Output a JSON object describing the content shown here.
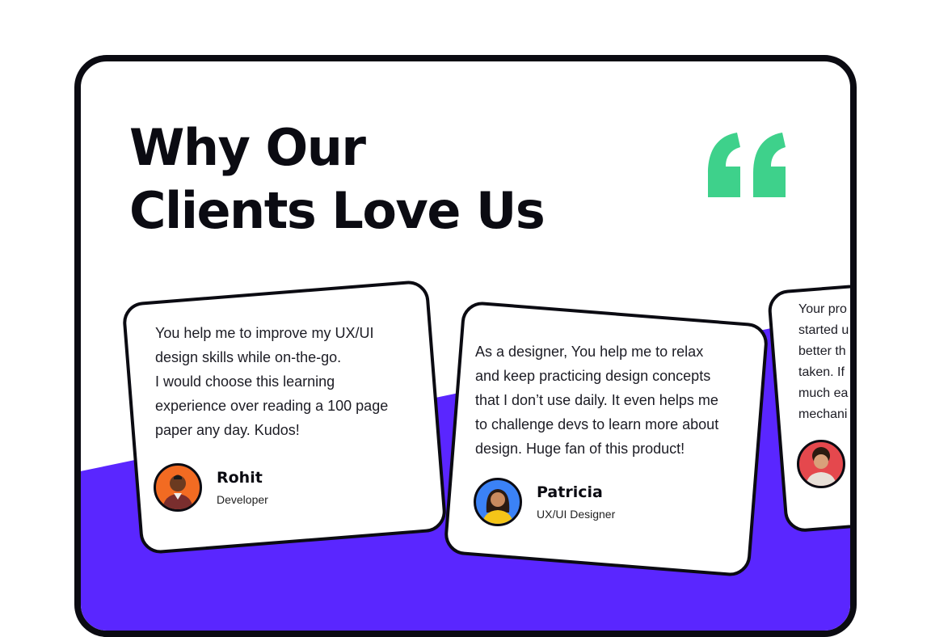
{
  "heading": {
    "line1": "Why Our",
    "line2": "Clients Love Us"
  },
  "quote_icon": {
    "name": "quote-icon",
    "color": "#3ed18b"
  },
  "colors": {
    "accent_purple": "#5a26ff",
    "border": "#0b0b12",
    "avatar_rohit": "#f26b22",
    "avatar_patricia": "#3b82f6",
    "avatar_third": "#e5484d"
  },
  "testimonials": [
    {
      "text": "You help me to improve my UX/UI\ndesign skills while on-the-go.\nI would choose this learning\nexperience over reading a 100 page\npaper any day. Kudos!",
      "name": "Rohit",
      "role": "Developer"
    },
    {
      "text": "As a designer, You help me to relax\nand keep practicing design concepts\nthat I don’t use daily. It even helps me\nto challenge devs to learn more about\ndesign. Huge fan of this product!",
      "name": "Patricia",
      "role": "UX/UI Designer"
    },
    {
      "text": "Your pro\nstarted u\nbetter th\ntaken. If\nmuch ea\nmechani"
    }
  ]
}
